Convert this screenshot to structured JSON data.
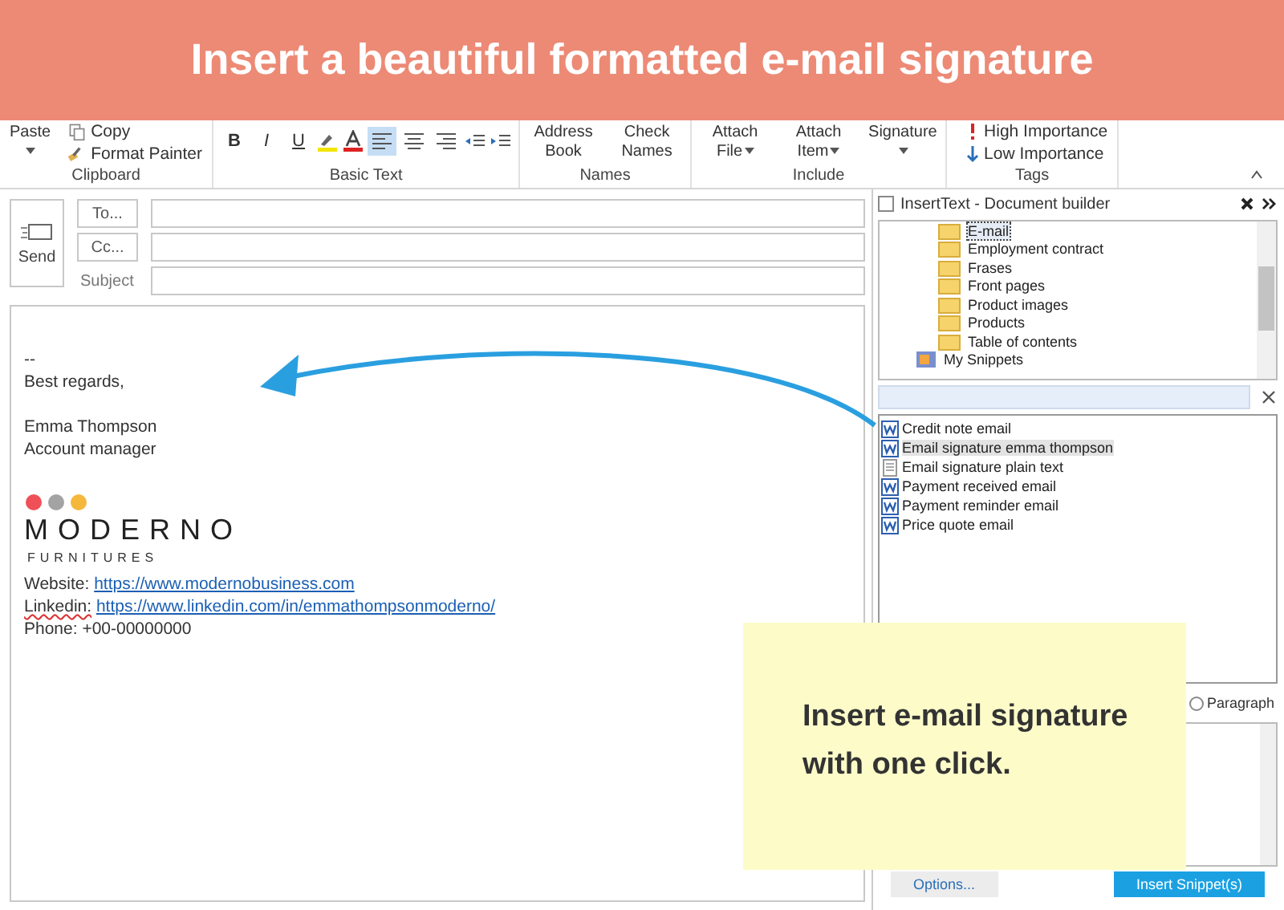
{
  "banner": {
    "text": "Insert a beautiful formatted e-mail signature"
  },
  "ribbon": {
    "groups": [
      {
        "kind": "clipboard",
        "label": "Clipboard",
        "big": "Paste",
        "small": [
          "Copy",
          "Format Painter"
        ]
      },
      {
        "kind": "basic-text",
        "label": "Basic Text",
        "format": [
          "B",
          "I",
          "U"
        ],
        "align": [
          {
            "selected": true
          },
          {
            "selected": false
          },
          {
            "selected": false
          }
        ]
      },
      {
        "kind": "big-buttons",
        "label": "Names",
        "buttons": [
          {
            "text": "Address Book",
            "dropdown": false
          },
          {
            "text": "Check Names",
            "dropdown": false
          }
        ]
      },
      {
        "kind": "big-buttons",
        "label": "Include",
        "buttons": [
          {
            "text": "Attach File",
            "dropdown": true
          },
          {
            "text": "Attach Item",
            "dropdown": true
          },
          {
            "text": "Signature",
            "dropdown": true
          }
        ]
      },
      {
        "kind": "tags",
        "label": "Tags",
        "small": [
          "High Importance",
          "Low Importance"
        ]
      }
    ]
  },
  "compose": {
    "send": "Send",
    "to": "To...",
    "cc": "Cc...",
    "subject_label": "Subject",
    "body": [
      {
        "kind": "text",
        "text": "--"
      },
      {
        "kind": "text",
        "text": "Best regards,"
      },
      {
        "kind": "blank"
      },
      {
        "kind": "text",
        "text": "Emma Thompson"
      },
      {
        "kind": "text",
        "text": "Account manager"
      },
      {
        "kind": "blank"
      },
      {
        "kind": "logo",
        "name": "MODERNO",
        "tagline": "FURNITURES"
      },
      {
        "kind": "link",
        "label": "Website:",
        "url": "https://www.modernobusiness.com",
        "misspelled": false
      },
      {
        "kind": "link",
        "label": "Linkedin:",
        "url": "https://www.linkedin.com/in/emmathompsonmoderno/",
        "misspelled": true
      },
      {
        "kind": "text",
        "text": "Phone: +00-00000000"
      }
    ]
  },
  "panel": {
    "title": "InsertText - Document builder",
    "tree": [
      {
        "label": "E-mail",
        "kind": "folder",
        "selected": true
      },
      {
        "label": "Employment contract",
        "kind": "folder",
        "selected": false
      },
      {
        "label": "Frases",
        "kind": "folder",
        "selected": false
      },
      {
        "label": "Front pages",
        "kind": "folder",
        "selected": false
      },
      {
        "label": "Product images",
        "kind": "folder",
        "selected": false
      },
      {
        "label": "Products",
        "kind": "folder",
        "selected": false
      },
      {
        "label": "Table of contents",
        "kind": "folder",
        "selected": false
      },
      {
        "label": "My Snippets",
        "kind": "collection",
        "selected": false
      }
    ],
    "snippets": [
      {
        "label": "Credit note email",
        "kind": "word",
        "selected": false
      },
      {
        "label": "Email signature emma thompson",
        "kind": "word",
        "selected": true
      },
      {
        "label": "Email signature plain text",
        "kind": "text",
        "selected": false
      },
      {
        "label": "Payment received email",
        "kind": "word",
        "selected": false
      },
      {
        "label": "Payment reminder email",
        "kind": "word",
        "selected": false
      },
      {
        "label": "Price quote email",
        "kind": "word",
        "selected": false
      }
    ],
    "after_options": [
      {
        "label": "Paragraph",
        "selected": false
      }
    ],
    "buttons": [
      {
        "text": "Options...",
        "kind": "secondary"
      },
      {
        "text": "Insert Snippet(s)",
        "kind": "primary"
      }
    ]
  },
  "callout": {
    "text": "Insert e-mail signature with one click."
  }
}
